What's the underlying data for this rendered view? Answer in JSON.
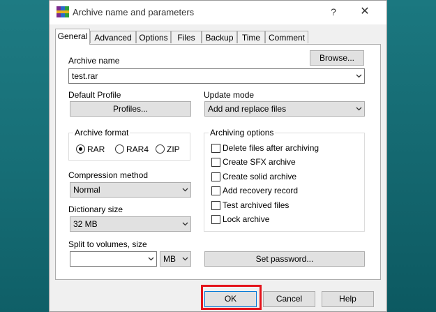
{
  "window": {
    "title": "Archive name and parameters",
    "help_glyph": "?",
    "close_glyph": "✕"
  },
  "tabs": [
    {
      "label": "General",
      "active": true
    },
    {
      "label": "Advanced"
    },
    {
      "label": "Options"
    },
    {
      "label": "Files"
    },
    {
      "label": "Backup"
    },
    {
      "label": "Time"
    },
    {
      "label": "Comment"
    }
  ],
  "general": {
    "archive_name_label": "Archive name",
    "browse_label": "Browse...",
    "archive_name_value": "test.rar",
    "default_profile_label": "Default Profile",
    "profiles_label": "Profiles...",
    "update_mode_label": "Update mode",
    "update_mode_value": "Add and replace files",
    "archive_format": {
      "label": "Archive format",
      "options": [
        "RAR",
        "RAR4",
        "ZIP"
      ],
      "selected": "RAR"
    },
    "compression_method_label": "Compression method",
    "compression_method_value": "Normal",
    "dictionary_size_label": "Dictionary size",
    "dictionary_size_value": "32 MB",
    "split_label": "Split to volumes, size",
    "split_value": "",
    "split_unit": "MB",
    "archiving_options": {
      "label": "Archiving options",
      "items": [
        {
          "label": "Delete files after archiving",
          "checked": false
        },
        {
          "label": "Create SFX archive",
          "checked": false
        },
        {
          "label": "Create solid archive",
          "checked": false
        },
        {
          "label": "Add recovery record",
          "checked": false
        },
        {
          "label": "Test archived files",
          "checked": false
        },
        {
          "label": "Lock archive",
          "checked": false
        }
      ]
    },
    "set_password_label": "Set password..."
  },
  "buttons": {
    "ok": "OK",
    "cancel": "Cancel",
    "help": "Help"
  },
  "colors": {
    "highlight": "#e4141b",
    "desktop": "#0f6a72"
  },
  "icons": [
    "winrar-app-icon",
    "chevron-down-icon",
    "question-icon",
    "close-icon"
  ]
}
